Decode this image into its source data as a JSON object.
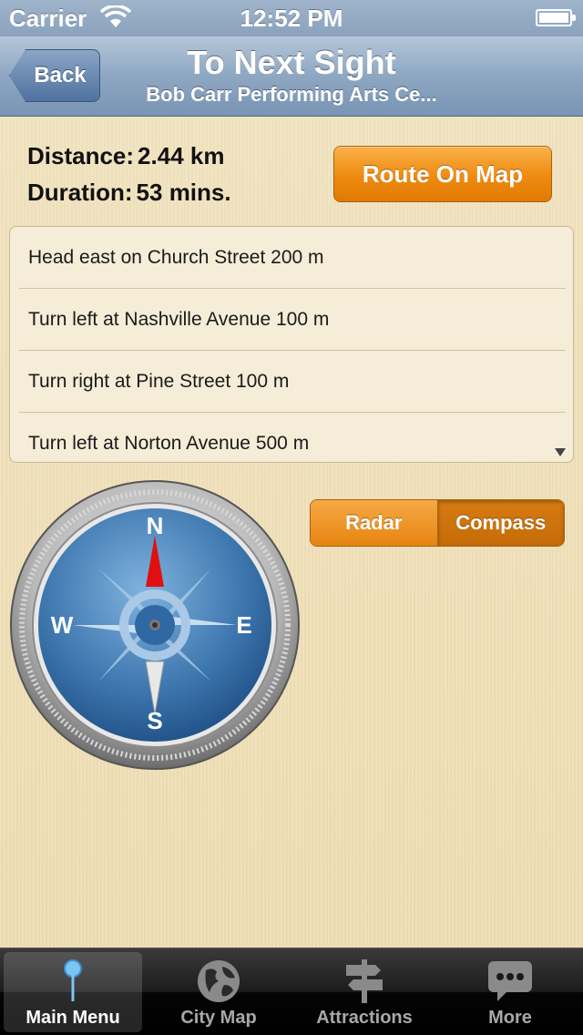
{
  "status_bar": {
    "carrier": "Carrier",
    "time": "12:52 PM"
  },
  "nav": {
    "back_label": "Back",
    "title": "To Next Sight",
    "subtitle": "Bob Carr Performing Arts Ce..."
  },
  "summary": {
    "distance_label": "Distance:",
    "distance_value": "2.44 km",
    "duration_label": "Duration:",
    "duration_value": "53 mins."
  },
  "route_button": "Route On Map",
  "directions": [
    "Head east on Church Street 200 m",
    "Turn left at Nashville Avenue 100 m",
    "Turn right at Pine Street 100 m",
    "Turn left at Norton Avenue 500 m"
  ],
  "compass": {
    "north": "N",
    "south": "S",
    "east": "E",
    "west": "W"
  },
  "mode_toggle": {
    "options": [
      "Radar",
      "Compass"
    ],
    "selected": "Compass"
  },
  "tabs": [
    {
      "label": "Main Menu",
      "icon": "pin-icon",
      "active": true
    },
    {
      "label": "City Map",
      "icon": "globe-icon",
      "active": false
    },
    {
      "label": "Attractions",
      "icon": "signpost-icon",
      "active": false
    },
    {
      "label": "More",
      "icon": "speech-bubble-icon",
      "active": false
    }
  ],
  "colors": {
    "accent_orange": "#ef8a0f",
    "nav_blue": "#8ea7c2",
    "background": "#f1e3bd"
  }
}
